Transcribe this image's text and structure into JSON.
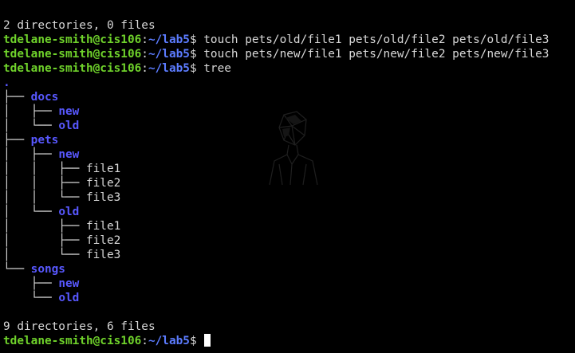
{
  "terminal": {
    "background": "#000000",
    "foreground": "#d8d8d8",
    "prompt_user_color": "#6fd22b",
    "prompt_path_color": "#5c7cff",
    "directory_color": "#5858ff",
    "lines": {
      "l01": {
        "text": "2 directories, 0 files"
      },
      "l02": {
        "user": "tdelane-smith@cis106",
        "colon": ":",
        "path": "~/lab5",
        "dollar": "$",
        "cmd": " touch pets/old/file1 pets/old/file2 pets/old/file3"
      },
      "l03": {
        "user": "tdelane-smith@cis106",
        "colon": ":",
        "path": "~/lab5",
        "dollar": "$",
        "cmd": " touch pets/new/file1 pets/new/file2 pets/new/file3"
      },
      "l04": {
        "user": "tdelane-smith@cis106",
        "colon": ":",
        "path": "~/lab5",
        "dollar": "$",
        "cmd": " tree"
      },
      "l05": {
        "name": "."
      },
      "l06": {
        "prefix": "├── ",
        "name": "docs"
      },
      "l07": {
        "prefix": "│   ├── ",
        "name": "new"
      },
      "l08": {
        "prefix": "│   └── ",
        "name": "old"
      },
      "l09": {
        "prefix": "├── ",
        "name": "pets"
      },
      "l10": {
        "prefix": "│   ├── ",
        "name": "new"
      },
      "l11": {
        "prefix": "│   │   ├── ",
        "name": "file1"
      },
      "l12": {
        "prefix": "│   │   ├── ",
        "name": "file2"
      },
      "l13": {
        "prefix": "│   │   └── ",
        "name": "file3"
      },
      "l14": {
        "prefix": "│   └── ",
        "name": "old"
      },
      "l15": {
        "prefix": "│       ├── ",
        "name": "file1"
      },
      "l16": {
        "prefix": "│       ├── ",
        "name": "file2"
      },
      "l17": {
        "prefix": "│       └── ",
        "name": "file3"
      },
      "l18": {
        "prefix": "└── ",
        "name": "songs"
      },
      "l19": {
        "prefix": "    ├── ",
        "name": "new"
      },
      "l20": {
        "prefix": "    └── ",
        "name": "old"
      },
      "l21": {
        "text": ""
      },
      "l22": {
        "text": "9 directories, 6 files"
      },
      "l23": {
        "user": "tdelane-smith@cis106",
        "colon": ":",
        "path": "~/lab5",
        "dollar": "$",
        "cmd": " "
      }
    }
  }
}
